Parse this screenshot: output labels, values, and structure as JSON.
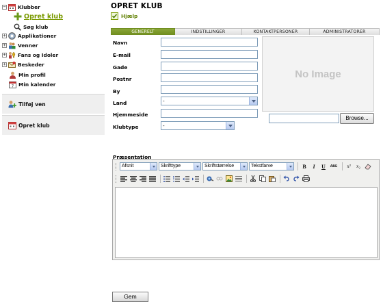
{
  "sidebar": {
    "tree": [
      {
        "label": "Klubber",
        "icon": "calendar-folder-icon",
        "expander": "−"
      },
      {
        "label": "Opret klub",
        "icon": "add-icon"
      },
      {
        "label": "Søg klub",
        "icon": "search-icon"
      },
      {
        "label": "Applikationer",
        "icon": "applications-icon",
        "expander": "+"
      },
      {
        "label": "Venner",
        "icon": "friends-icon",
        "expander": "+"
      },
      {
        "label": "Fans og Idoler",
        "icon": "fans-icon",
        "expander": "+"
      },
      {
        "label": "Beskeder",
        "icon": "messages-icon",
        "expander": "+"
      },
      {
        "label": "Min profil",
        "icon": "profile-icon"
      },
      {
        "label": "Min kalender",
        "icon": "calendar-icon"
      }
    ],
    "add_friend_label": "Tilføj ven",
    "create_club_label": "Opret klub"
  },
  "main": {
    "title": "OPRET KLUB",
    "help_label": "Hjælp",
    "tabs": [
      "GENERELT",
      "INDSTILLINGER",
      "KONTAKTPERSONER",
      "ADMINISTRATORER"
    ],
    "active_tab": "GENERELT",
    "fields": {
      "name_label": "Navn",
      "email_label": "E-mail",
      "street_label": "Gade",
      "postal_label": "Postnr",
      "city_label": "By",
      "country_label": "Land",
      "country_value": "-",
      "website_label": "Hjemmeside",
      "clubtype_label": "Klubtype",
      "clubtype_value": "-"
    },
    "image": {
      "placeholder": "No Image",
      "browse_label": "Browse..."
    },
    "presentation": {
      "label": "Præsentation",
      "paragraph_select": "Afsnit",
      "font_select": "Skrifttype",
      "size_select": "Skriftstørrelse",
      "color_select": "Tekstfarve",
      "bold": "B",
      "italic": "I",
      "underline": "U",
      "strikethrough": "ABC",
      "superscript": "x²",
      "subscript": "x₂"
    },
    "save_label": "Gem"
  },
  "colors": {
    "accent_green": "#7a9a00",
    "tab_active": "#7a962a",
    "input_border": "#7f9db9"
  }
}
